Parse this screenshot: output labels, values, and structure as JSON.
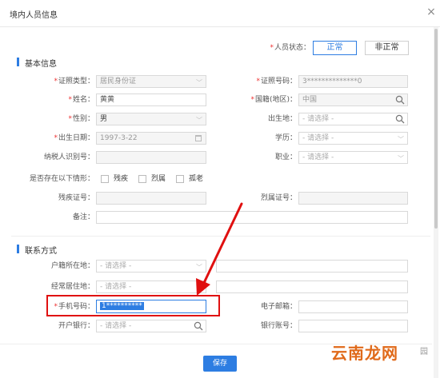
{
  "dialog": {
    "title": "境内人员信息",
    "close": "×"
  },
  "status": {
    "label": "人员状态：",
    "normal": "正常",
    "abnormal": "非正常"
  },
  "basic": {
    "title": "基本信息",
    "id_type_label": "证照类型：",
    "id_type_value": "居民身份证",
    "id_number_label": "证照号码：",
    "id_number_value": "3**************0",
    "name_label": "姓名：",
    "name_value": "黄黄",
    "nationality_label": "国籍(地区)：",
    "nationality_value": "中国",
    "gender_label": "性别：",
    "gender_value": "男",
    "birthplace_label": "出生地：",
    "birthplace_placeholder": "- 请选择 -",
    "birthdate_label": "出生日期：",
    "birthdate_value": "1997-3-22",
    "education_label": "学历：",
    "education_placeholder": "- 请选择 -",
    "taxid_label": "纳税人识别号：",
    "occupation_label": "职业：",
    "occupation_placeholder": "- 请选择 -",
    "situation_label": "是否存在以下情形：",
    "situation_options": [
      "残疾",
      "烈属",
      "孤老"
    ],
    "disability_label": "残疾证号：",
    "martyr_label": "烈属证号：",
    "remark_label": "备注："
  },
  "contact": {
    "title": "联系方式",
    "household_label": "户籍所在地：",
    "household_placeholder": "- 请选择 -",
    "residence_label": "经常居住地：",
    "residence_placeholder": "- 请选择 -",
    "phone_label": "手机号码：",
    "phone_value": "1**********",
    "email_label": "电子邮箱：",
    "bank_label": "开户银行：",
    "bank_placeholder": "- 请选择 -",
    "account_label": "银行账号："
  },
  "actions": {
    "save": "保存"
  },
  "watermark": {
    "brand": "云南龙网",
    "suffix": "园"
  },
  "colors": {
    "accent": "#2d7de2",
    "required": "#e33333",
    "annotation": "#e01010"
  }
}
